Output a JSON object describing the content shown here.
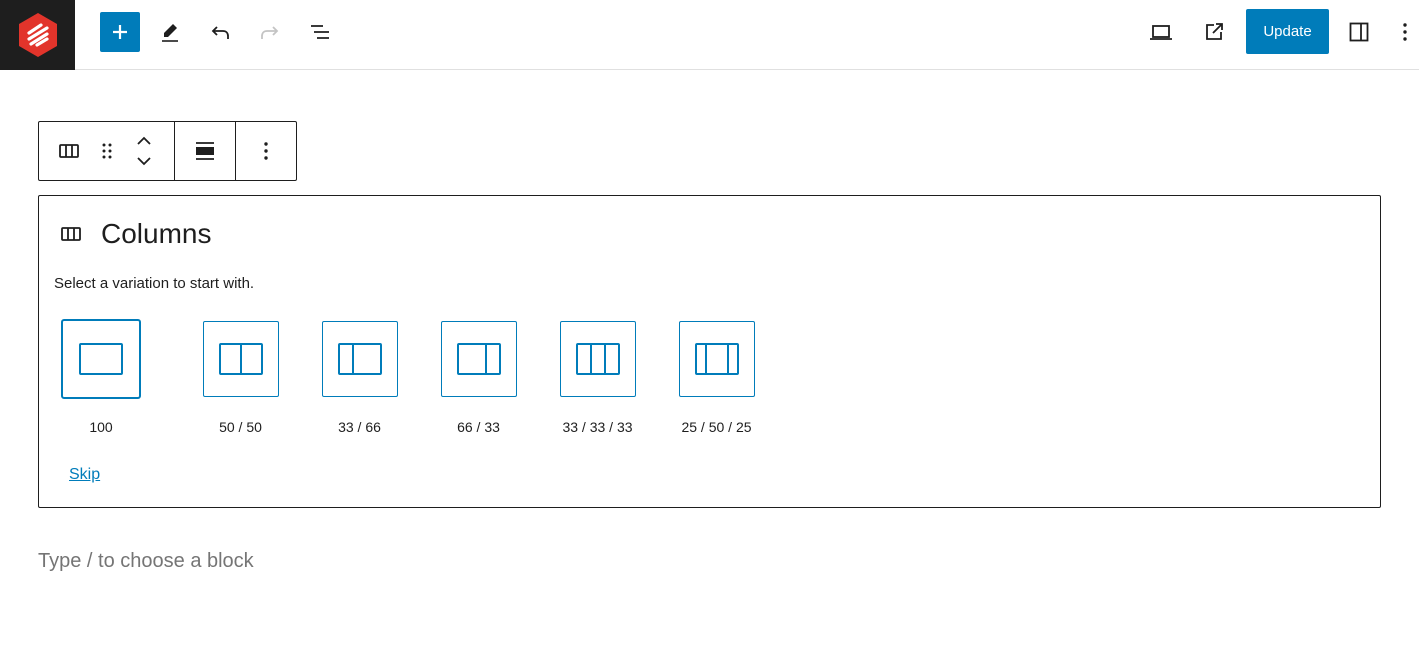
{
  "topbar": {
    "logo_icon": "editor-logo-icon",
    "add_icon": "plus-icon",
    "tools_icon": "pencil-icon",
    "undo_icon": "undo-icon",
    "redo_icon": "redo-icon",
    "list_view_icon": "document-overview-icon",
    "preview_icon": "laptop-icon",
    "view_post_icon": "external-link-icon",
    "update_label": "Update",
    "settings_icon": "sidebar-toggle-icon",
    "options_icon": "vertical-ellipsis-icon"
  },
  "block_toolbar": {
    "block_icon": "columns-icon",
    "drag_icon": "drag-handle-icon",
    "move_up_icon": "chevron-up-icon",
    "move_down_icon": "chevron-down-icon",
    "align_icon": "align-wide-icon",
    "more_icon": "vertical-ellipsis-icon"
  },
  "placeholder": {
    "icon": "columns-icon",
    "title": "Columns",
    "instructions": "Select a variation to start with.",
    "variations": [
      {
        "label": "100",
        "icon": "columns-100-icon"
      },
      {
        "label": "50 / 50",
        "icon": "columns-50-50-icon"
      },
      {
        "label": "33 / 66",
        "icon": "columns-33-66-icon"
      },
      {
        "label": "66 / 33",
        "icon": "columns-66-33-icon"
      },
      {
        "label": "33 / 33 / 33",
        "icon": "columns-33-33-33-icon"
      },
      {
        "label": "25 / 50 / 25",
        "icon": "columns-25-50-25-icon"
      }
    ],
    "skip_label": "Skip"
  },
  "appender": {
    "placeholder": "Type / to choose a block"
  },
  "colors": {
    "accent": "#007cba",
    "logo_red": "#e2342b",
    "logo_bg": "#1e1e1e"
  }
}
